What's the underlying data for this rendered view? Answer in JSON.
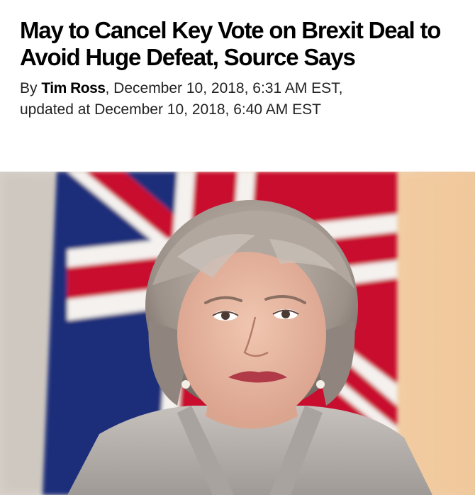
{
  "article": {
    "headline": "May to Cancel Key Vote on Brexit Deal to Avoid Huge Defeat, Source Says",
    "byline_prefix": "By ",
    "author": "Tim Ross",
    "published": ", December 10, 2018, 6:31 AM EST,",
    "updated": "updated at December 10, 2018, 6:40 AM EST"
  },
  "hero_image": {
    "subject": "portrait photo in front of union flag",
    "colors": {
      "flag_red": "#c8102e",
      "flag_blue": "#1f2f7a",
      "flag_white": "#f4f1ee",
      "background_warm": "#f1d9b4",
      "hair": "#a79c93",
      "skin": "#e8b9a3",
      "jacket": "#b7b2ae"
    }
  }
}
